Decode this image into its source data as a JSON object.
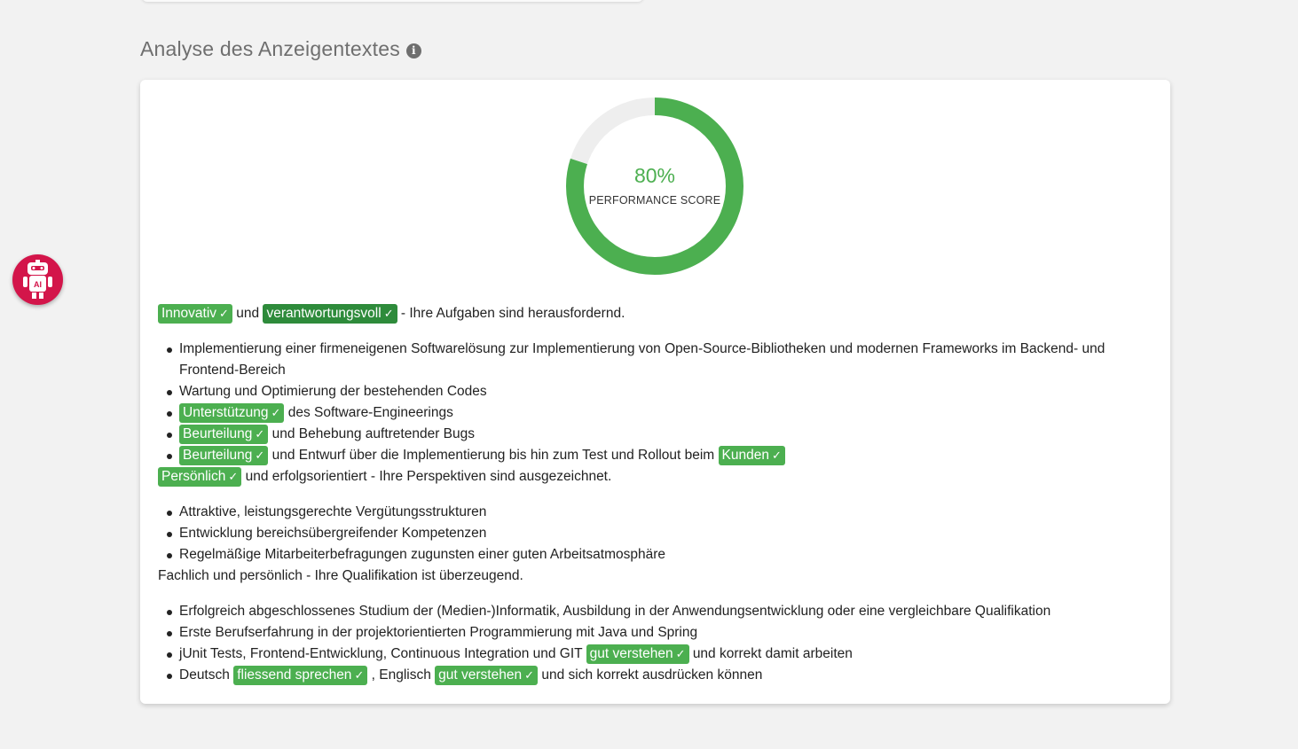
{
  "section": {
    "title": "Analyse des Anzeigentextes",
    "info_icon": "info-icon"
  },
  "gauge": {
    "value_text": "80%",
    "value": 0.8,
    "label": "PERFORMANCE SCORE",
    "color": "#4caf50",
    "track_color": "#eeeeee"
  },
  "intro1": {
    "tag1": "Innovativ",
    "mid": "und",
    "tag2": "verantwortungsvoll",
    "rest": "- Ihre Aufgaben sind herausfordernd."
  },
  "tasks": {
    "item1": "Implementierung einer firmeneigenen Softwarelösung zur Implementierung von Open-Source-Bibliotheken und modernen Frameworks im Backend- und Frontend-Bereich",
    "item2": "Wartung und Optimierung der bestehenden Codes",
    "item3_tag": "Unterstützung",
    "item3_rest": "des Software-Engineerings",
    "item4_tag": "Beurteilung",
    "item4_rest": "und Behebung auftretender Bugs",
    "item5_tag": "Beurteilung",
    "item5_rest": "und Entwurf über die Implementierung bis hin zum Test und Rollout beim",
    "item5_tag2": "Kunden"
  },
  "intro2": {
    "tag": "Persönlich",
    "rest": "und erfolgsorientiert - Ihre Perspektiven sind ausgezeichnet."
  },
  "benefits": [
    "Attraktive, leistungsgerechte Vergütungsstrukturen",
    "Entwicklung bereichsübergreifender Kompetenzen",
    "Regelmäßige Mitarbeiterbefragungen zugunsten einer guten Arbeitsatmosphäre"
  ],
  "intro3": "Fachlich und persönlich - Ihre Qualifikation ist überzeugend.",
  "quals": {
    "item1": "Erfolgreich abgeschlossenes Studium der (Medien-)Informatik, Ausbildung in der Anwendungsentwicklung oder eine vergleichbare Qualifikation",
    "item2": "Erste Berufserfahrung in der projektorientierten Programmierung mit Java und Spring",
    "item3_pre": "jUnit Tests, Frontend-Entwicklung, Continuous Integration und GIT",
    "item3_tag": "gut verstehen",
    "item3_rest": "und korrekt damit arbeiten",
    "item4_pre": "Deutsch",
    "item4_tag1": "fliessend sprechen",
    "item4_mid": ", Englisch",
    "item4_tag2": "gut verstehen",
    "item4_rest": "und sich korrekt ausdrücken können"
  },
  "check_glyph": "✓",
  "assistant": {
    "icon": "robot-icon",
    "label": "AI"
  }
}
